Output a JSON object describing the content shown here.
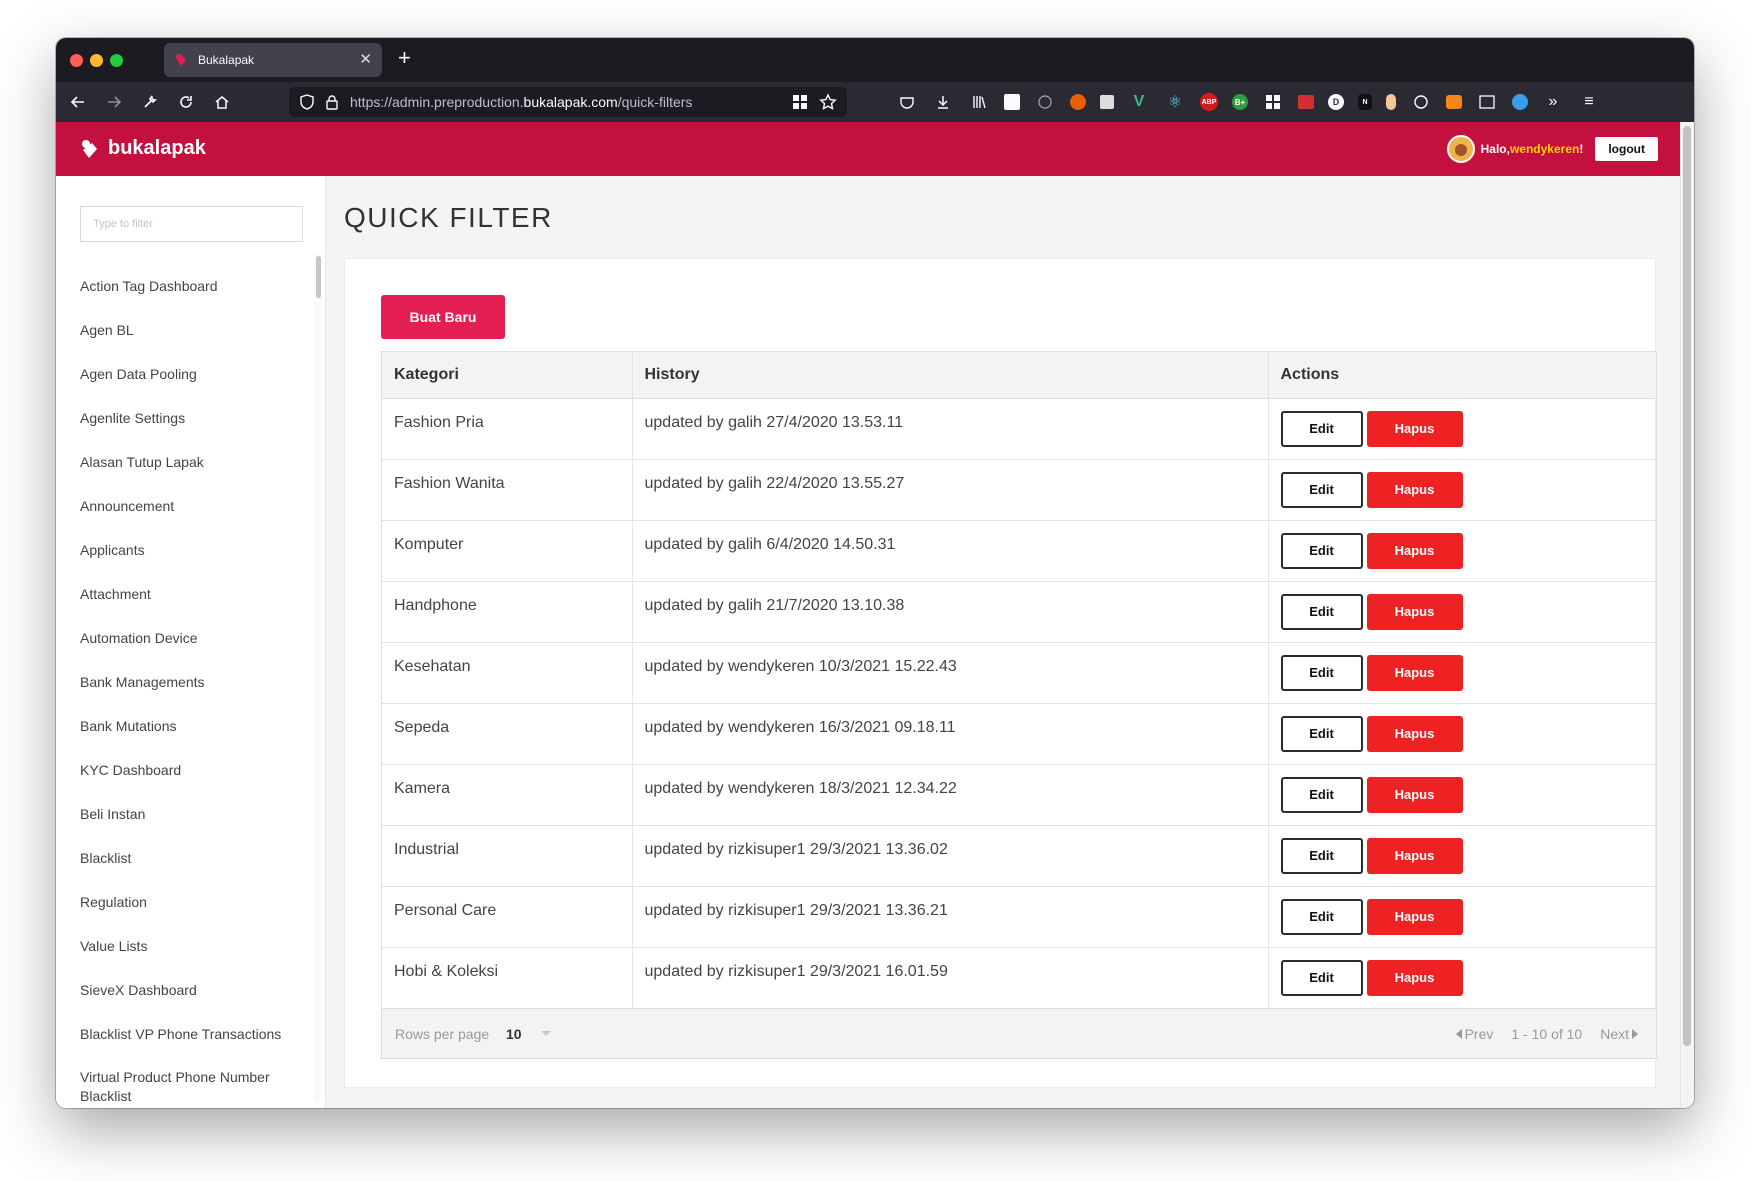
{
  "browser": {
    "tab_title": "Bukalapak",
    "url_prefix": "https://admin.preproduction.",
    "url_host": "bukalapak.com",
    "url_path": "/quick-filters"
  },
  "header": {
    "brand": "bukalapak",
    "greeting": "Halo, ",
    "username": "wendykeren",
    "greeting_suffix": "!",
    "logout_label": "logout",
    "brand_color": "#c4103f"
  },
  "sidebar": {
    "filter_placeholder": "Type to filter",
    "items": [
      {
        "label": "Action Tag Dashboard"
      },
      {
        "label": "Agen BL"
      },
      {
        "label": "Agen Data Pooling"
      },
      {
        "label": "Agenlite Settings"
      },
      {
        "label": "Alasan Tutup Lapak"
      },
      {
        "label": "Announcement"
      },
      {
        "label": "Applicants"
      },
      {
        "label": "Attachment"
      },
      {
        "label": "Automation Device"
      },
      {
        "label": "Bank Managements"
      },
      {
        "label": "Bank Mutations"
      },
      {
        "label": "KYC Dashboard"
      },
      {
        "label": "Beli Instan"
      },
      {
        "label": "Blacklist"
      },
      {
        "label": "Regulation"
      },
      {
        "label": "Value Lists"
      },
      {
        "label": "SieveX Dashboard"
      },
      {
        "label": "Blacklist VP Phone Transactions"
      },
      {
        "label": "Virtual Product Phone Number Blacklist"
      }
    ]
  },
  "main": {
    "page_title": "QUICK FILTER",
    "create_label": "Buat Baru",
    "columns": {
      "kategori": "Kategori",
      "history": "History",
      "actions": "Actions"
    },
    "edit_label": "Edit",
    "delete_label": "Hapus",
    "rows": [
      {
        "kategori": "Fashion Pria",
        "history": "updated by galih 27/4/2020 13.53.11"
      },
      {
        "kategori": "Fashion Wanita",
        "history": "updated by galih 22/4/2020 13.55.27"
      },
      {
        "kategori": "Komputer",
        "history": "updated by galih 6/4/2020 14.50.31"
      },
      {
        "kategori": "Handphone",
        "history": "updated by galih 21/7/2020 13.10.38"
      },
      {
        "kategori": "Kesehatan",
        "history": "updated by wendykeren 10/3/2021 15.22.43"
      },
      {
        "kategori": "Sepeda",
        "history": "updated by wendykeren 16/3/2021 09.18.11"
      },
      {
        "kategori": "Kamera",
        "history": "updated by wendykeren 18/3/2021 12.34.22"
      },
      {
        "kategori": "Industrial",
        "history": "updated by rizkisuper1 29/3/2021 13.36.02"
      },
      {
        "kategori": "Personal Care",
        "history": "updated by rizkisuper1 29/3/2021 13.36.21"
      },
      {
        "kategori": "Hobi & Koleksi",
        "history": "updated by rizkisuper1 29/3/2021 16.01.59"
      }
    ],
    "footer": {
      "rows_per_page_label": "Rows per page",
      "rows_per_page_value": "10",
      "prev_label": "Prev",
      "range_label": "1 - 10 of 10",
      "next_label": "Next"
    }
  }
}
